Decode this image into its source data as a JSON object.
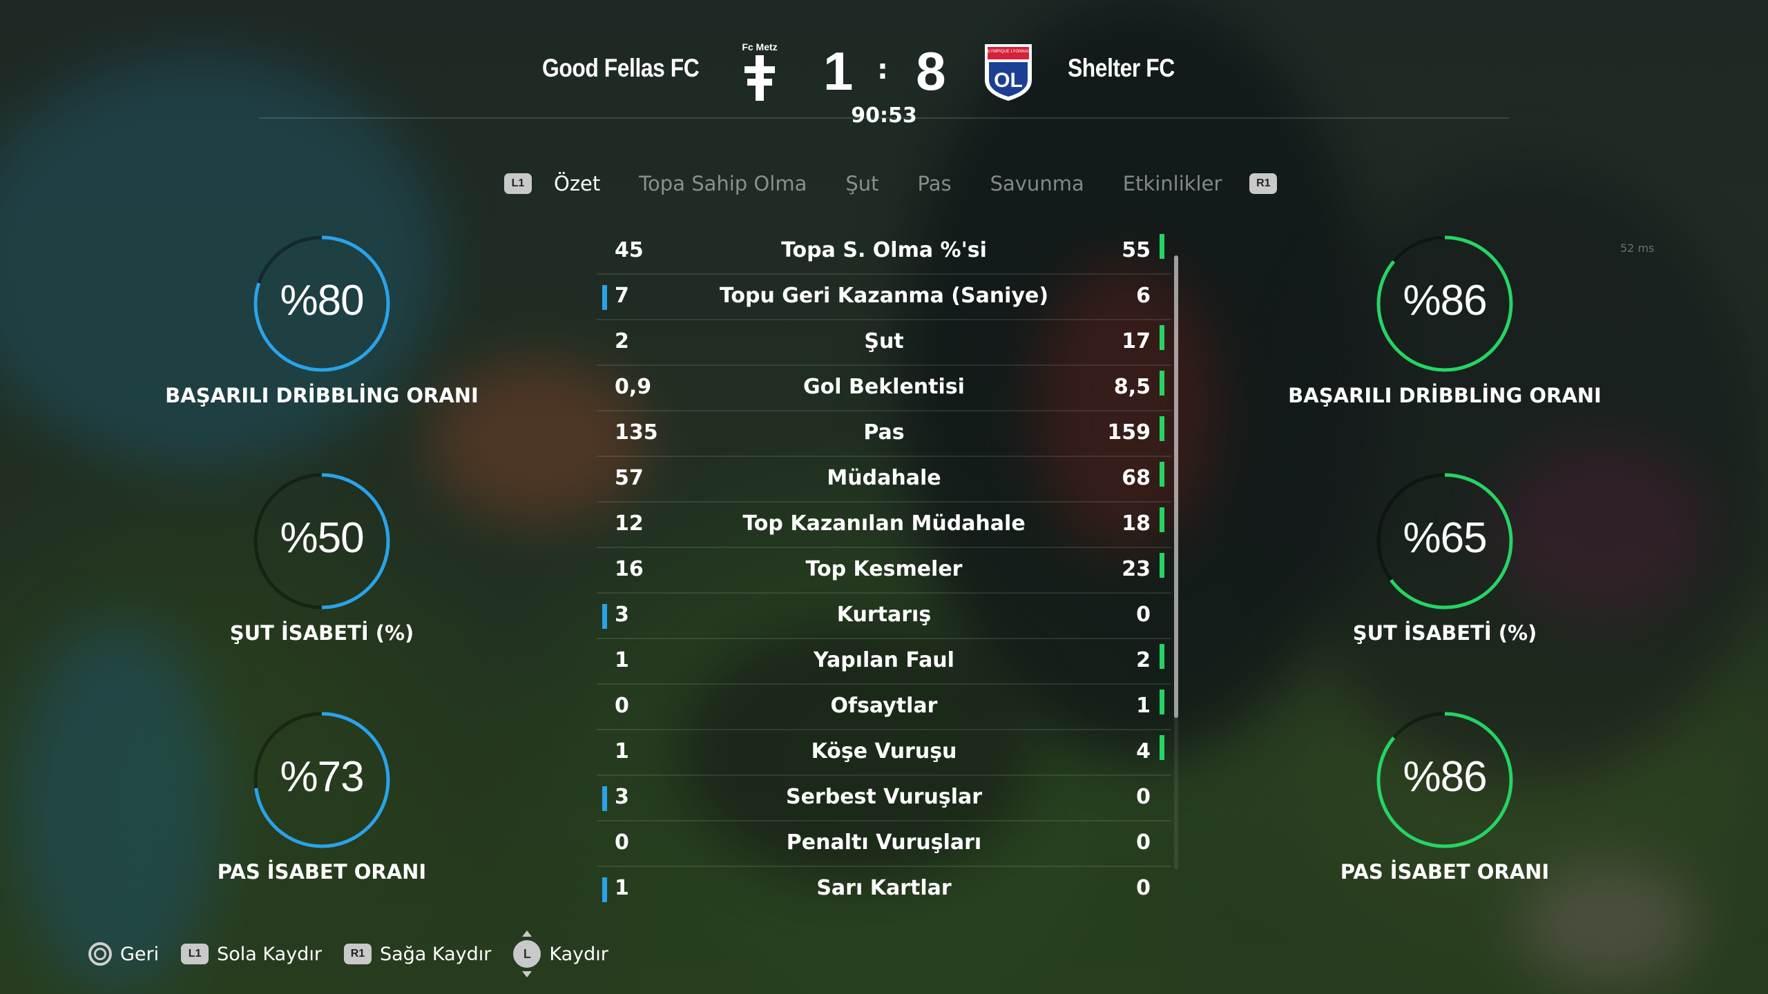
{
  "match": {
    "home_team": "Good Fellas FC",
    "away_team": "Shelter FC",
    "home_badge_label": "Fc Metz",
    "away_badge_text": "OL",
    "away_badge_banner": "OLYMPIQUE LYONNAIS",
    "home_score": "1",
    "away_score": "8",
    "separator": ":",
    "clock": "90:53"
  },
  "tabs": {
    "left_hint": "L1",
    "right_hint": "R1",
    "items": [
      {
        "label": "Özet",
        "active": true
      },
      {
        "label": "Topa Sahip Olma",
        "active": false
      },
      {
        "label": "Şut",
        "active": false
      },
      {
        "label": "Pas",
        "active": false
      },
      {
        "label": "Savunma",
        "active": false
      },
      {
        "label": "Etkinlikler",
        "active": false
      }
    ]
  },
  "stats": [
    {
      "label": "Topa S. Olma %'si",
      "home": "45",
      "away": "55",
      "leader": "away"
    },
    {
      "label": "Topu Geri Kazanma (Saniye)",
      "home": "7",
      "away": "6",
      "leader": "home"
    },
    {
      "label": "Şut",
      "home": "2",
      "away": "17",
      "leader": "away"
    },
    {
      "label": "Gol Beklentisi",
      "home": "0,9",
      "away": "8,5",
      "leader": "away"
    },
    {
      "label": "Pas",
      "home": "135",
      "away": "159",
      "leader": "away"
    },
    {
      "label": "Müdahale",
      "home": "57",
      "away": "68",
      "leader": "away"
    },
    {
      "label": "Top Kazanılan Müdahale",
      "home": "12",
      "away": "18",
      "leader": "away"
    },
    {
      "label": "Top Kesmeler",
      "home": "16",
      "away": "23",
      "leader": "away"
    },
    {
      "label": "Kurtarış",
      "home": "3",
      "away": "0",
      "leader": "home"
    },
    {
      "label": "Yapılan Faul",
      "home": "1",
      "away": "2",
      "leader": "away"
    },
    {
      "label": "Ofsaytlar",
      "home": "0",
      "away": "1",
      "leader": "away"
    },
    {
      "label": "Köşe Vuruşu",
      "home": "1",
      "away": "4",
      "leader": "away"
    },
    {
      "label": "Serbest Vuruşlar",
      "home": "3",
      "away": "0",
      "leader": "home"
    },
    {
      "label": "Penaltı Vuruşları",
      "home": "0",
      "away": "0",
      "leader": "none"
    },
    {
      "label": "Sarı Kartlar",
      "home": "1",
      "away": "0",
      "leader": "home"
    }
  ],
  "gauges": {
    "home": [
      {
        "value": "%80",
        "percent": 80,
        "label": "BAŞARILI DRİBBLİNG ORANI"
      },
      {
        "value": "%50",
        "percent": 50,
        "label": "ŞUT İSABETİ (%)"
      },
      {
        "value": "%73",
        "percent": 73,
        "label": "PAS İSABET ORANI"
      }
    ],
    "away": [
      {
        "value": "%86",
        "percent": 86,
        "label": "BAŞARILI DRİBBLİNG ORANI"
      },
      {
        "value": "%65",
        "percent": 65,
        "label": "ŞUT İSABETİ (%)"
      },
      {
        "value": "%86",
        "percent": 86,
        "label": "PAS İSABET ORANI"
      }
    ]
  },
  "ping": "52 ms",
  "footer": {
    "back_label": "Geri",
    "l1_hint": "L1",
    "left_label": "Sola Kaydır",
    "r1_hint": "R1",
    "right_label": "Sağa Kaydır",
    "stick_hint": "L",
    "scroll_label": "Kaydır"
  },
  "colors": {
    "home_accent": "#2aa3e8",
    "away_accent": "#26d464"
  }
}
